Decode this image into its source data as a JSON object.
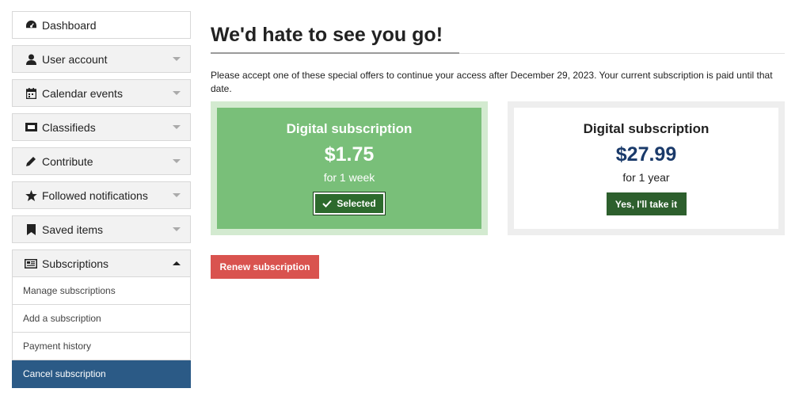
{
  "sidebar": {
    "items": [
      {
        "label": "Dashboard",
        "icon": "dashboard-icon"
      },
      {
        "label": "User account",
        "icon": "user-icon"
      },
      {
        "label": "Calendar events",
        "icon": "calendar-icon"
      },
      {
        "label": "Classifieds",
        "icon": "ticket-icon"
      },
      {
        "label": "Contribute",
        "icon": "pencil-icon"
      },
      {
        "label": "Followed notifications",
        "icon": "star-icon"
      },
      {
        "label": "Saved items",
        "icon": "bookmark-icon"
      },
      {
        "label": "Subscriptions",
        "icon": "newspaper-icon"
      }
    ],
    "subitems": [
      {
        "label": "Manage subscriptions"
      },
      {
        "label": "Add a subscription"
      },
      {
        "label": "Payment history"
      },
      {
        "label": "Cancel subscription"
      }
    ]
  },
  "main": {
    "title": "We'd hate to see you go!",
    "intro": "Please accept one of these special offers to continue your access after December 29, 2023. Your current subscription is paid until that date.",
    "offers": [
      {
        "name": "Digital subscription",
        "price": "$1.75",
        "period": "for 1 week",
        "button": "Selected"
      },
      {
        "name": "Digital subscription",
        "price": "$27.99",
        "period": "for 1 year",
        "button": "Yes, I'll take it"
      }
    ],
    "renew_label": "Renew subscription"
  },
  "colors": {
    "selected_bg": "#79bf79",
    "active_nav": "#2b5a86",
    "renew_button": "#d9534f",
    "price_blue": "#1a3a6a"
  }
}
